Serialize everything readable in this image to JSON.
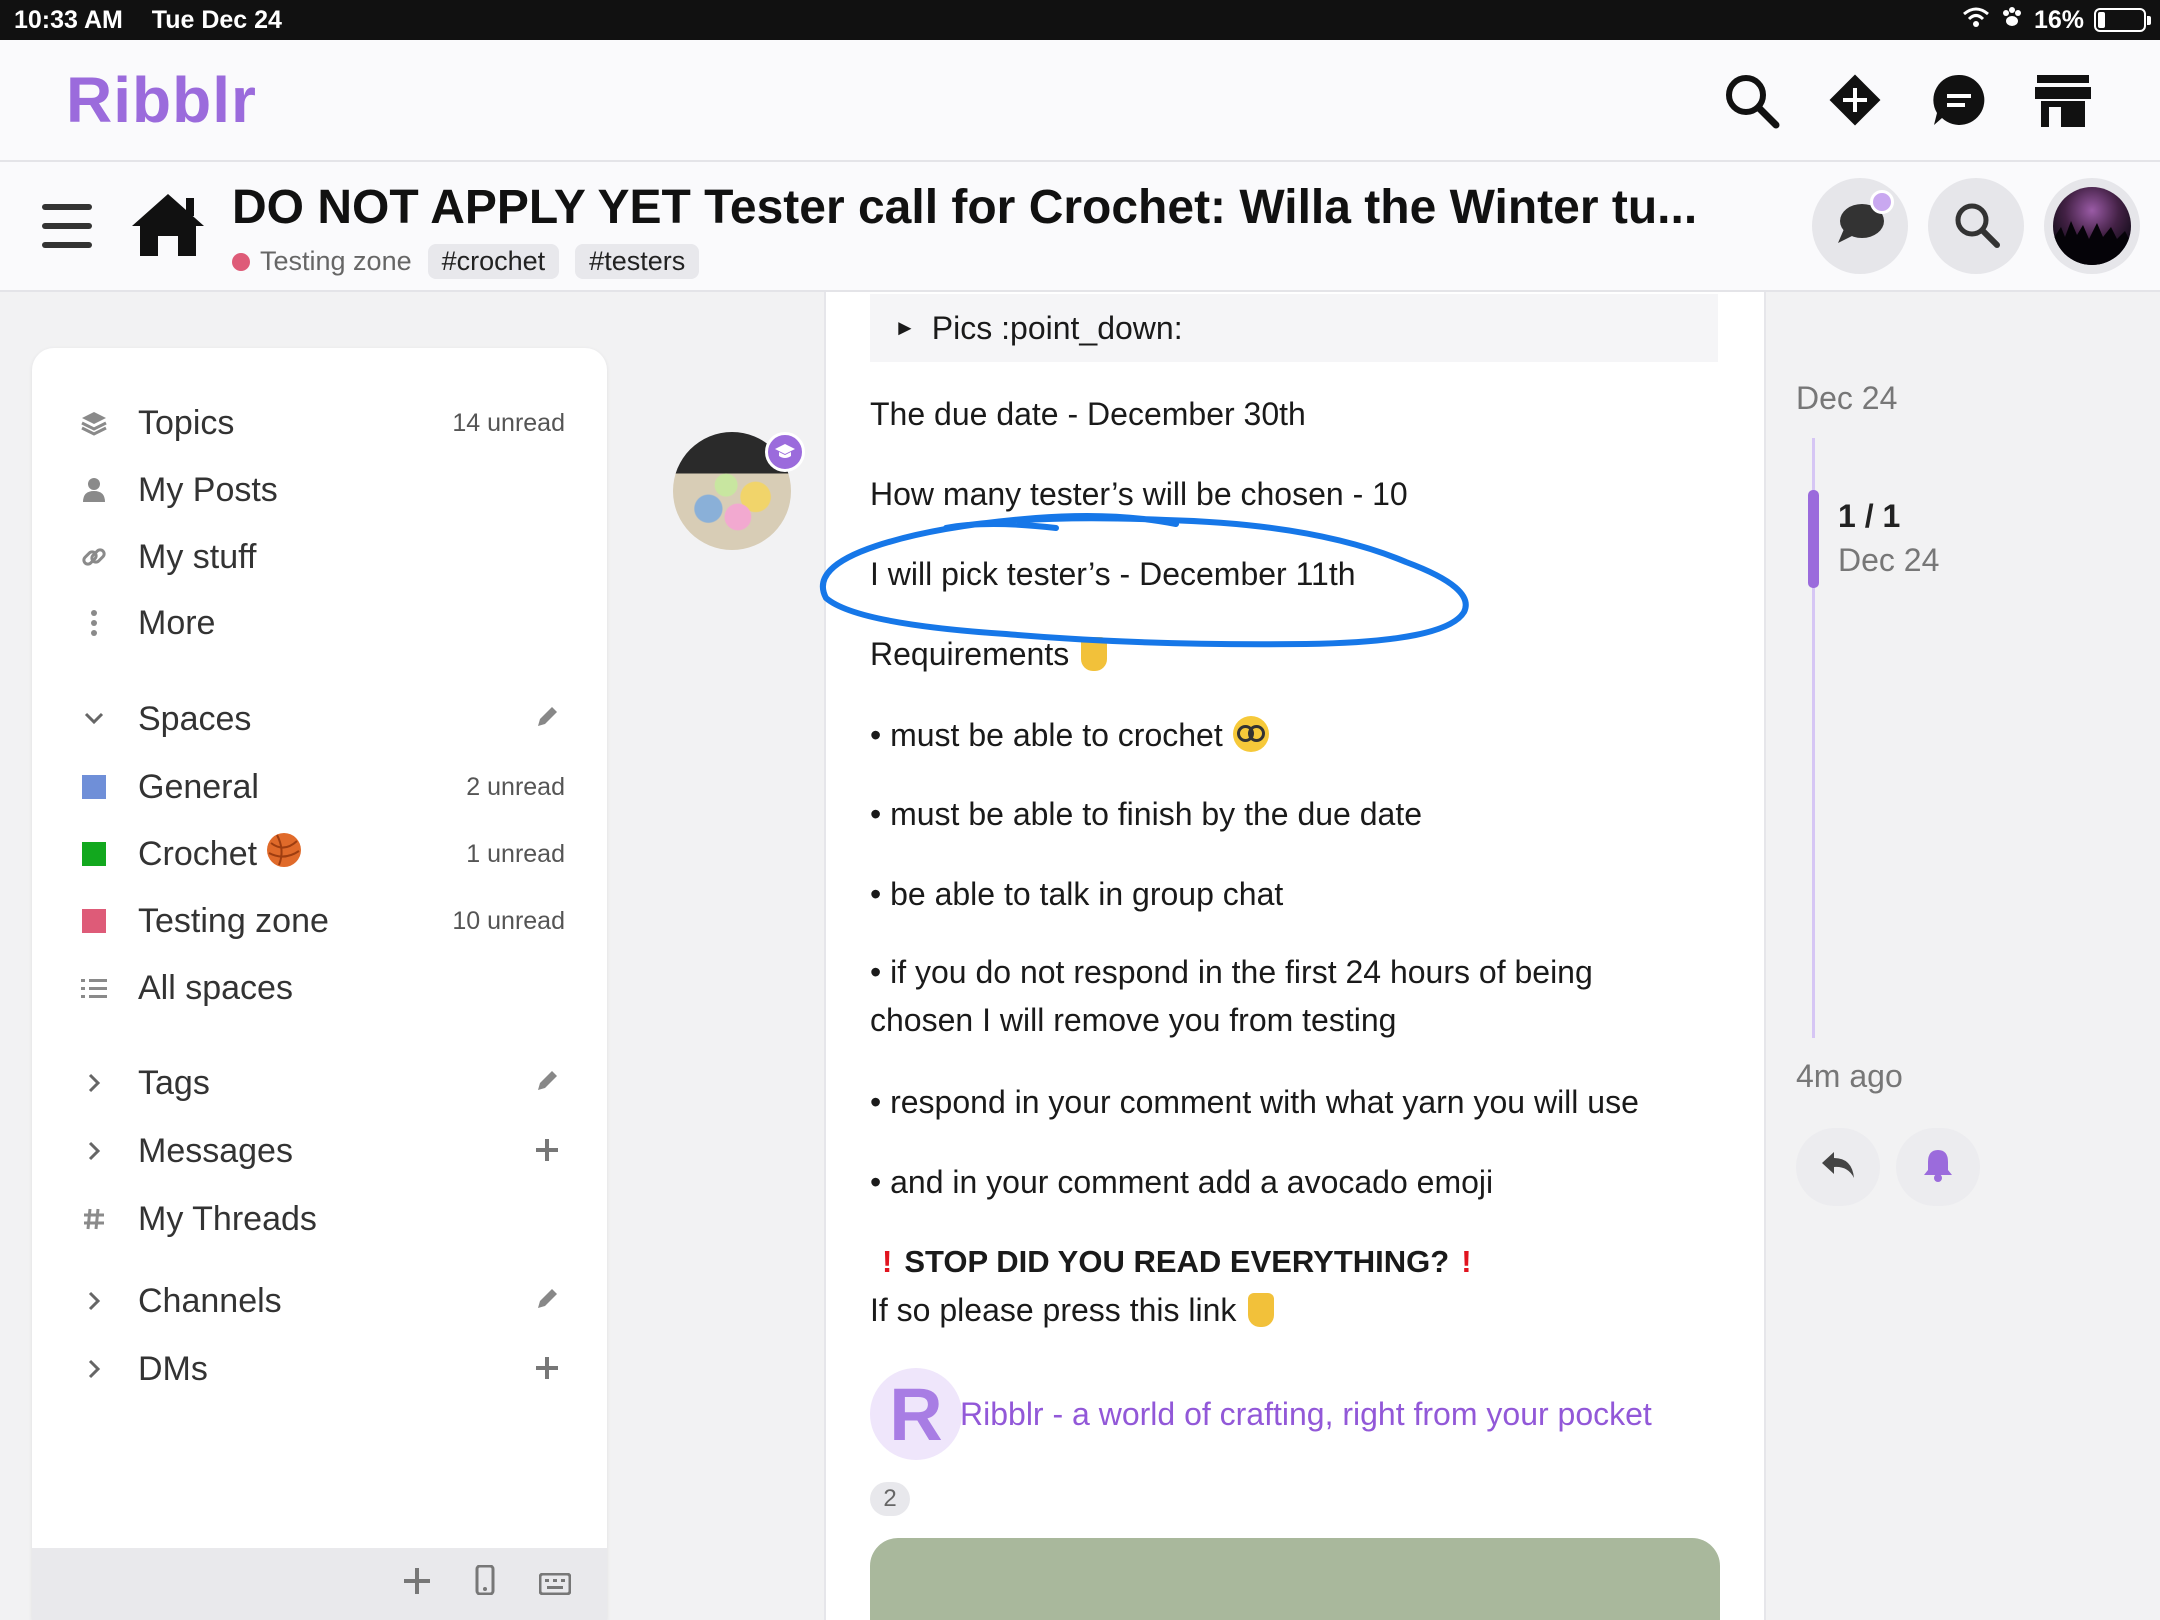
{
  "status_bar": {
    "time": "10:33 AM",
    "date": "Tue Dec 24",
    "battery": "16%",
    "battery_level": 0.16
  },
  "header": {
    "logo": "Ribblr"
  },
  "topic": {
    "title": "DO NOT APPLY YET Tester call for Crochet: Willa the Winter tu...",
    "category": "Testing zone",
    "tags": [
      "#crochet",
      "#testers"
    ]
  },
  "sidebar": {
    "topics": {
      "label": "Topics",
      "count": "14 unread"
    },
    "my_posts": "My Posts",
    "my_stuff": "My stuff",
    "more": "More",
    "spaces": "Spaces",
    "general": {
      "label": "General",
      "count": "2 unread",
      "color": "#6f8fd8"
    },
    "crochet": {
      "label": "Crochet",
      "count": "1 unread",
      "color": "#12a81e"
    },
    "testing_zone": {
      "label": "Testing zone",
      "count": "10 unread",
      "color": "#de5b78"
    },
    "all_spaces": "All spaces",
    "tags": "Tags",
    "messages": "Messages",
    "my_threads": "My Threads",
    "channels": "Channels",
    "dms": "DMs"
  },
  "post": {
    "details_summary": "Pics :point_down:",
    "due_date": "The due date - December 30th",
    "testers_count": "How many tester’s will be chosen - 10",
    "pick_date": "I will pick tester’s - December 11th",
    "requirements": "Requirements",
    "req1": "• must be able to crochet",
    "req2": "• must be able to finish by the due date",
    "req3": "• be able to talk in group chat",
    "req4": "• if you do not respond in the first 24 hours of being chosen I will remove you from testing",
    "req5": "• respond in your comment with what yarn you will use",
    "req6": "• and in your comment add a avocado emoji",
    "stop_line": "STOP DID YOU READ EVERYTHING?",
    "press_link": "If so please press this link",
    "link_logo": "R",
    "link_text": "Ribblr - a world of crafting, right from your pocket",
    "link_clicks": "2"
  },
  "timeline": {
    "date": "Dec 24",
    "position": "1 / 1",
    "position_date": "Dec 24",
    "ago": "4m ago"
  },
  "colors": {
    "brand": "#9b6bdc",
    "annotation": "#1677e8",
    "warning": "#e1141f"
  }
}
